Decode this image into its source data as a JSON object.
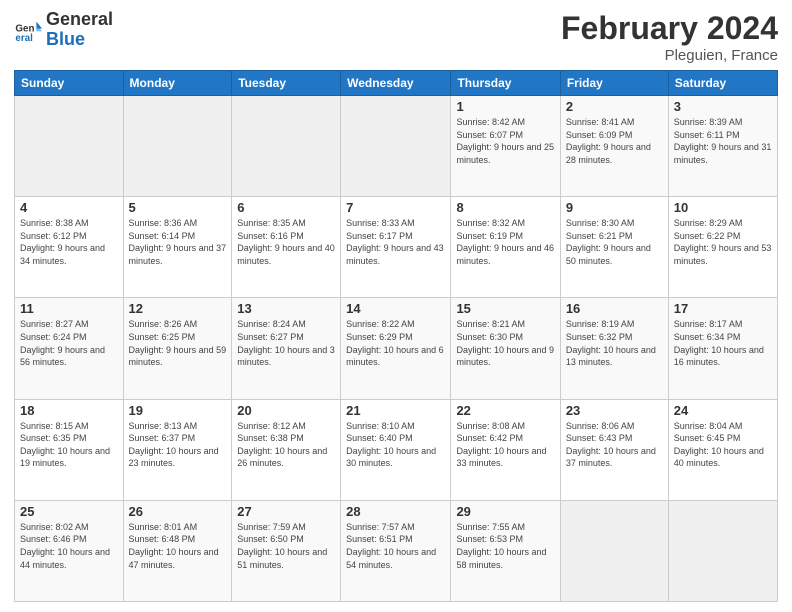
{
  "logo": {
    "general": "General",
    "blue": "Blue"
  },
  "header": {
    "month_year": "February 2024",
    "location": "Pleguien, France"
  },
  "weekdays": [
    "Sunday",
    "Monday",
    "Tuesday",
    "Wednesday",
    "Thursday",
    "Friday",
    "Saturday"
  ],
  "weeks": [
    {
      "days": [
        {
          "number": "",
          "info": ""
        },
        {
          "number": "",
          "info": ""
        },
        {
          "number": "",
          "info": ""
        },
        {
          "number": "",
          "info": ""
        },
        {
          "number": "1",
          "info": "Sunrise: 8:42 AM\nSunset: 6:07 PM\nDaylight: 9 hours and 25 minutes."
        },
        {
          "number": "2",
          "info": "Sunrise: 8:41 AM\nSunset: 6:09 PM\nDaylight: 9 hours and 28 minutes."
        },
        {
          "number": "3",
          "info": "Sunrise: 8:39 AM\nSunset: 6:11 PM\nDaylight: 9 hours and 31 minutes."
        }
      ]
    },
    {
      "days": [
        {
          "number": "4",
          "info": "Sunrise: 8:38 AM\nSunset: 6:12 PM\nDaylight: 9 hours and 34 minutes."
        },
        {
          "number": "5",
          "info": "Sunrise: 8:36 AM\nSunset: 6:14 PM\nDaylight: 9 hours and 37 minutes."
        },
        {
          "number": "6",
          "info": "Sunrise: 8:35 AM\nSunset: 6:16 PM\nDaylight: 9 hours and 40 minutes."
        },
        {
          "number": "7",
          "info": "Sunrise: 8:33 AM\nSunset: 6:17 PM\nDaylight: 9 hours and 43 minutes."
        },
        {
          "number": "8",
          "info": "Sunrise: 8:32 AM\nSunset: 6:19 PM\nDaylight: 9 hours and 46 minutes."
        },
        {
          "number": "9",
          "info": "Sunrise: 8:30 AM\nSunset: 6:21 PM\nDaylight: 9 hours and 50 minutes."
        },
        {
          "number": "10",
          "info": "Sunrise: 8:29 AM\nSunset: 6:22 PM\nDaylight: 9 hours and 53 minutes."
        }
      ]
    },
    {
      "days": [
        {
          "number": "11",
          "info": "Sunrise: 8:27 AM\nSunset: 6:24 PM\nDaylight: 9 hours and 56 minutes."
        },
        {
          "number": "12",
          "info": "Sunrise: 8:26 AM\nSunset: 6:25 PM\nDaylight: 9 hours and 59 minutes."
        },
        {
          "number": "13",
          "info": "Sunrise: 8:24 AM\nSunset: 6:27 PM\nDaylight: 10 hours and 3 minutes."
        },
        {
          "number": "14",
          "info": "Sunrise: 8:22 AM\nSunset: 6:29 PM\nDaylight: 10 hours and 6 minutes."
        },
        {
          "number": "15",
          "info": "Sunrise: 8:21 AM\nSunset: 6:30 PM\nDaylight: 10 hours and 9 minutes."
        },
        {
          "number": "16",
          "info": "Sunrise: 8:19 AM\nSunset: 6:32 PM\nDaylight: 10 hours and 13 minutes."
        },
        {
          "number": "17",
          "info": "Sunrise: 8:17 AM\nSunset: 6:34 PM\nDaylight: 10 hours and 16 minutes."
        }
      ]
    },
    {
      "days": [
        {
          "number": "18",
          "info": "Sunrise: 8:15 AM\nSunset: 6:35 PM\nDaylight: 10 hours and 19 minutes."
        },
        {
          "number": "19",
          "info": "Sunrise: 8:13 AM\nSunset: 6:37 PM\nDaylight: 10 hours and 23 minutes."
        },
        {
          "number": "20",
          "info": "Sunrise: 8:12 AM\nSunset: 6:38 PM\nDaylight: 10 hours and 26 minutes."
        },
        {
          "number": "21",
          "info": "Sunrise: 8:10 AM\nSunset: 6:40 PM\nDaylight: 10 hours and 30 minutes."
        },
        {
          "number": "22",
          "info": "Sunrise: 8:08 AM\nSunset: 6:42 PM\nDaylight: 10 hours and 33 minutes."
        },
        {
          "number": "23",
          "info": "Sunrise: 8:06 AM\nSunset: 6:43 PM\nDaylight: 10 hours and 37 minutes."
        },
        {
          "number": "24",
          "info": "Sunrise: 8:04 AM\nSunset: 6:45 PM\nDaylight: 10 hours and 40 minutes."
        }
      ]
    },
    {
      "days": [
        {
          "number": "25",
          "info": "Sunrise: 8:02 AM\nSunset: 6:46 PM\nDaylight: 10 hours and 44 minutes."
        },
        {
          "number": "26",
          "info": "Sunrise: 8:01 AM\nSunset: 6:48 PM\nDaylight: 10 hours and 47 minutes."
        },
        {
          "number": "27",
          "info": "Sunrise: 7:59 AM\nSunset: 6:50 PM\nDaylight: 10 hours and 51 minutes."
        },
        {
          "number": "28",
          "info": "Sunrise: 7:57 AM\nSunset: 6:51 PM\nDaylight: 10 hours and 54 minutes."
        },
        {
          "number": "29",
          "info": "Sunrise: 7:55 AM\nSunset: 6:53 PM\nDaylight: 10 hours and 58 minutes."
        },
        {
          "number": "",
          "info": ""
        },
        {
          "number": "",
          "info": ""
        }
      ]
    }
  ]
}
